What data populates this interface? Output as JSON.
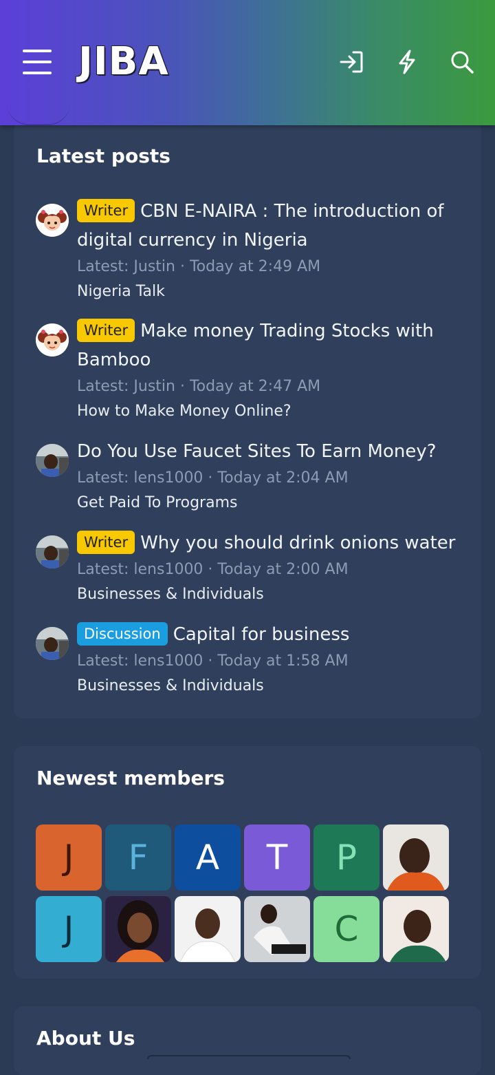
{
  "header": {
    "logo_text": "JIBA",
    "icons": [
      "menu-icon",
      "login-icon",
      "whats-new-icon",
      "search-icon"
    ]
  },
  "latest_posts": {
    "title": "Latest posts",
    "items": [
      {
        "badge": "Writer",
        "badge_type": "writer",
        "title": "CBN E-NAIRA : The introduction of digital currency in Nigeria",
        "meta": "Latest: Justin · Today at 2:49 AM",
        "forum": "Nigeria Talk",
        "avatar": "cartoon-girl"
      },
      {
        "badge": "Writer",
        "badge_type": "writer",
        "title": "Make money Trading Stocks with Bamboo",
        "meta": "Latest: Justin · Today at 2:47 AM",
        "forum": "How to Make Money Online?",
        "avatar": "cartoon-girl"
      },
      {
        "badge": "",
        "badge_type": "",
        "title": "Do You Use Faucet Sites To Earn Money?",
        "meta": "Latest: lens1000 · Today at 2:04 AM",
        "forum": "Get Paid To Programs",
        "avatar": "photo-man"
      },
      {
        "badge": "Writer",
        "badge_type": "writer",
        "title": "Why you should drink onions water",
        "meta": "Latest: lens1000 · Today at 2:00 AM",
        "forum": "Businesses & Individuals",
        "avatar": "photo-man"
      },
      {
        "badge": "Discussion",
        "badge_type": "discussion",
        "title": "Capital for business",
        "meta": "Latest: lens1000 · Today at 1:58 AM",
        "forum": "Businesses & Individuals",
        "avatar": "photo-man"
      }
    ]
  },
  "newest_members": {
    "title": "Newest members",
    "members": [
      {
        "letter": "J",
        "bg": "#d9642e",
        "fg": "#3d1608"
      },
      {
        "letter": "F",
        "bg": "#1f5a7a",
        "fg": "#5bb3dd"
      },
      {
        "letter": "A",
        "bg": "#0d4f9e",
        "fg": "#ffffff"
      },
      {
        "letter": "T",
        "bg": "#7a5ad6",
        "fg": "#ffffff"
      },
      {
        "letter": "P",
        "bg": "#1e7a56",
        "fg": "#86e0b8"
      },
      {
        "letter": "",
        "photo": "man-orange-shirt"
      },
      {
        "letter": "J",
        "bg": "#33aed2",
        "fg": "#0d2a3a"
      },
      {
        "letter": "",
        "photo": "woman-portrait"
      },
      {
        "letter": "",
        "photo": "man-white-shirt"
      },
      {
        "letter": "",
        "photo": "man-sitting"
      },
      {
        "letter": "C",
        "bg": "#86dd9a",
        "fg": "#1f6a38"
      },
      {
        "letter": "",
        "photo": "man-green-shirt"
      }
    ]
  },
  "about": {
    "title": "About Us"
  }
}
